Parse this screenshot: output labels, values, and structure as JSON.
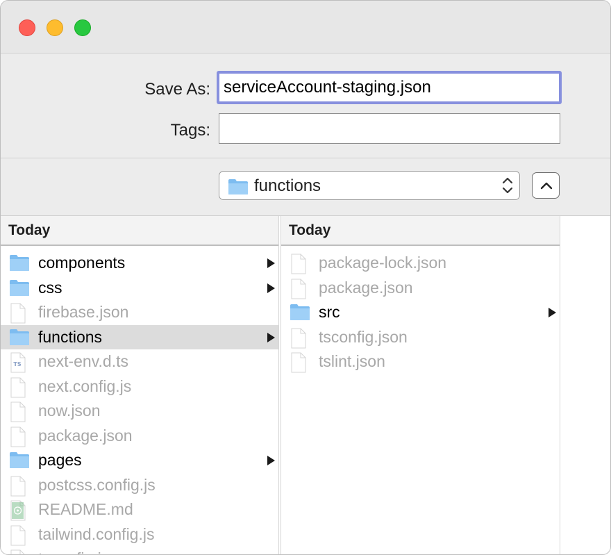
{
  "save_as": {
    "label": "Save As:",
    "value": "serviceAccount-staging.json"
  },
  "tags": {
    "label": "Tags:",
    "value": ""
  },
  "location": {
    "current": "functions"
  },
  "column1": {
    "header": "Today",
    "items": [
      {
        "name": "components",
        "kind": "folder"
      },
      {
        "name": "css",
        "kind": "folder"
      },
      {
        "name": "firebase.json",
        "kind": "file"
      },
      {
        "name": "functions",
        "kind": "folder",
        "selected": true
      },
      {
        "name": "next-env.d.ts",
        "kind": "ts-file"
      },
      {
        "name": "next.config.js",
        "kind": "file"
      },
      {
        "name": "now.json",
        "kind": "file"
      },
      {
        "name": "package.json",
        "kind": "file"
      },
      {
        "name": "pages",
        "kind": "folder"
      },
      {
        "name": "postcss.config.js",
        "kind": "file"
      },
      {
        "name": "README.md",
        "kind": "md-file"
      },
      {
        "name": "tailwind.config.js",
        "kind": "file"
      },
      {
        "name": "tsconfig.json",
        "kind": "file"
      }
    ]
  },
  "column2": {
    "header": "Today",
    "items": [
      {
        "name": "package-lock.json",
        "kind": "file"
      },
      {
        "name": "package.json",
        "kind": "file"
      },
      {
        "name": "src",
        "kind": "folder"
      },
      {
        "name": "tsconfig.json",
        "kind": "file"
      },
      {
        "name": "tslint.json",
        "kind": "file"
      }
    ]
  },
  "icons": {
    "folder": "folder-icon",
    "file": "document-icon",
    "ts-file": "typescript-file-icon",
    "md-file": "markdown-file-icon",
    "disclosure": "chevron-right-icon"
  },
  "colors": {
    "folder": "#7dbcf0",
    "focus_ring": "#8790de",
    "selection": "#dcdcdc",
    "disabled_text": "#a8a8a8"
  }
}
